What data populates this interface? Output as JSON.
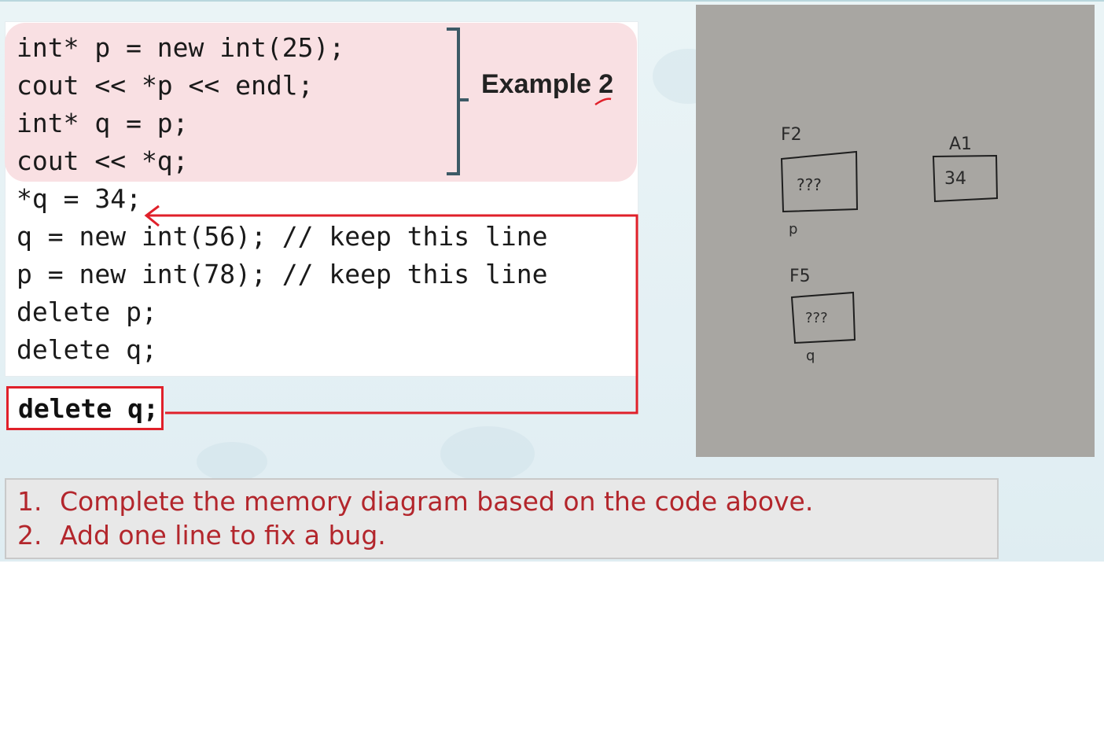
{
  "code": {
    "lines": [
      "int* p = new int(25);",
      "cout << *p << endl;",
      "int* q = p;",
      "cout << *q;",
      "*q = 34;",
      "q = new int(56); // keep this line",
      "p = new int(78); // keep this line",
      "delete p;",
      "delete q;"
    ],
    "example_label": "Example 2",
    "fix_line": "delete q;"
  },
  "diagram": {
    "boxes": [
      {
        "address": "F2",
        "value": "???",
        "pointer": "p"
      },
      {
        "address": "A1",
        "value": "34",
        "pointer": ""
      },
      {
        "address": "F5",
        "value": "???",
        "pointer": "q"
      }
    ]
  },
  "tasks": [
    {
      "num": "1.",
      "text": "Complete the memory diagram based on the code above."
    },
    {
      "num": "2.",
      "text": "Add one line to fix a bug."
    }
  ],
  "colors": {
    "highlight": "#f9e0e3",
    "annotation_red": "#e0202a",
    "task_text": "#b3262c",
    "bracket": "#3d5a66",
    "paper": "#a8a6a2"
  }
}
